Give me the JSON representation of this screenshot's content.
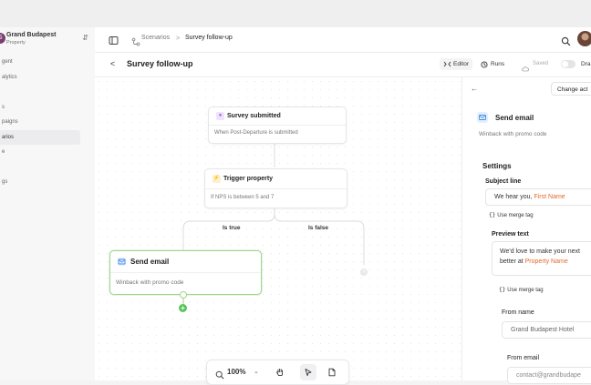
{
  "org": {
    "name": "Grand Budapest",
    "subtitle": "Property",
    "logo_letter": "G"
  },
  "sidebar": {
    "items": [
      {
        "label": "gent",
        "active": false
      },
      {
        "label": "alytics",
        "active": false
      },
      {
        "label": "",
        "active": false
      },
      {
        "label": "s",
        "active": false
      },
      {
        "label": "paigns",
        "active": false
      },
      {
        "label": "arios",
        "active": false
      },
      {
        "label": "e",
        "active": false
      },
      {
        "label": "",
        "active": false
      },
      {
        "label": "gs",
        "active": false
      }
    ]
  },
  "breadcrumb": {
    "section": "Scenarios",
    "separator": ">",
    "current": "Survey follow-up"
  },
  "page": {
    "back_glyph": "<",
    "title": "Survey follow-up"
  },
  "tabs": {
    "editor": "Editor",
    "runs": "Runs"
  },
  "status": {
    "saved": "Saved",
    "draft": "Dra"
  },
  "nodes": {
    "trigger": {
      "title": "Survey submitted",
      "description": "When Post-Departure is submitted"
    },
    "condition": {
      "title": "Trigger property",
      "description": "If NPS is between 5 and 7"
    },
    "action": {
      "title": "Send email",
      "description": "Winback with promo code"
    }
  },
  "branches": {
    "true_label": "Is true",
    "false_label": "Is false"
  },
  "toolbar": {
    "zoom": "100%"
  },
  "panel": {
    "back_glyph": "←",
    "change_action": "Change act",
    "title": "Send email",
    "description": "Winback with promo code",
    "settings_title": "Settings",
    "subject": {
      "label": "Subject line",
      "text": "We hear you,",
      "merge": "First Name"
    },
    "preview": {
      "label": "Preview text",
      "line1": "We'd love to make your next",
      "line2": "better at",
      "merge": "Property Name"
    },
    "merge_tag": "Use merge tag",
    "from_name": {
      "label": "From name",
      "value": "Grand Budapest Hotel"
    },
    "from_email": {
      "label": "From email",
      "value": "contact@grandbudape"
    }
  },
  "colors": {
    "accent_green": "#58c55a",
    "merge_orange": "#e46a2a",
    "trigger_purple": "#a35be8",
    "condition_amber": "#f2b43a",
    "email_blue": "#4a8fe7"
  },
  "icons": {
    "panel_toggle": "sidebar-icon",
    "scenario": "route-icon",
    "search": "search-icon",
    "editor": "code-icon",
    "runs": "runs-icon",
    "saved": "cloud-check-icon",
    "trigger": "survey-icon",
    "condition": "bolt-icon",
    "email": "mail-icon",
    "zoom": "zoom-icon",
    "hand": "hand-icon",
    "pointer": "pointer-icon",
    "note": "note-icon"
  }
}
